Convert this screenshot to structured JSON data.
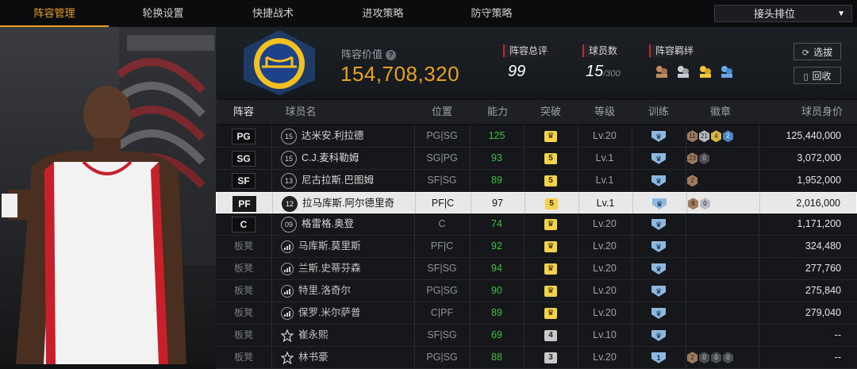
{
  "tabs": [
    {
      "label": "阵容管理",
      "active": true
    },
    {
      "label": "轮换设置",
      "active": false
    },
    {
      "label": "快捷战术",
      "active": false
    },
    {
      "label": "进攻策略",
      "active": false
    },
    {
      "label": "防守策略",
      "active": false
    }
  ],
  "dropdown": {
    "selected": "接头排位"
  },
  "header": {
    "value_label": "阵容价值",
    "value": "154,708,320",
    "rating_label": "阵容总评",
    "rating": "99",
    "player_count_label": "球员数",
    "player_count": "15",
    "player_count_max": "/300",
    "bond_label": "阵容羁绊",
    "btn_select": "选拔",
    "btn_recycle": "回收"
  },
  "columns": [
    "阵容",
    "球员名",
    "位置",
    "能力",
    "突破",
    "等级",
    "训练",
    "徽章",
    "球员身价"
  ],
  "players": [
    {
      "slot": "PG",
      "bench": false,
      "jersey": "15",
      "name": "达米安.利拉德",
      "pos": "PG|SG",
      "ability": "125",
      "breakthrough": "crown",
      "level": "Lv.20",
      "train": "crown",
      "badges": [
        {
          "t": "bronze",
          "v": "11"
        },
        {
          "t": "silver",
          "v": "21"
        },
        {
          "t": "gold",
          "v": "4"
        },
        {
          "t": "blue",
          "v": "2"
        }
      ],
      "worth": "125,440,000"
    },
    {
      "slot": "SG",
      "bench": false,
      "jersey": "15",
      "name": "C.J.麦科勒姆",
      "pos": "SG|PG",
      "ability": "93",
      "breakthrough": "5",
      "level": "Lv.1",
      "train": "crown",
      "badges": [
        {
          "t": "bronze",
          "v": "23"
        },
        {
          "t": "dark",
          "v": "0"
        }
      ],
      "worth": "3,072,000"
    },
    {
      "slot": "SF",
      "bench": false,
      "jersey": "13",
      "name": "尼古拉斯.巴图姆",
      "pos": "SF|SG",
      "ability": "89",
      "breakthrough": "5",
      "level": "Lv.1",
      "train": "crown",
      "badges": [
        {
          "t": "bronze",
          "v": "2"
        }
      ],
      "worth": "1,952,000"
    },
    {
      "slot": "PF",
      "bench": false,
      "jersey": "12",
      "name": "拉马库斯.阿尔德里奇",
      "pos": "PF|C",
      "ability": "97",
      "breakthrough": "5",
      "level": "Lv.1",
      "train": "crown",
      "badges": [
        {
          "t": "bronze",
          "v": "8"
        },
        {
          "t": "silver",
          "v": "0"
        }
      ],
      "worth": "2,016,000",
      "selected": true
    },
    {
      "slot": "C",
      "bench": false,
      "jersey": "09",
      "name": "格雷格.奥登",
      "pos": "C",
      "ability": "74",
      "breakthrough": "crown",
      "level": "Lv.20",
      "train": "crown",
      "badges": [],
      "worth": "1,171,200"
    },
    {
      "slot": "板凳",
      "bench": true,
      "icon": "rank",
      "name": "马库斯.莫里斯",
      "pos": "PF|C",
      "ability": "92",
      "breakthrough": "crown",
      "level": "Lv.20",
      "train": "crown",
      "badges": [],
      "worth": "324,480"
    },
    {
      "slot": "板凳",
      "bench": true,
      "icon": "rank",
      "name": "兰斯.史蒂芬森",
      "pos": "SF|SG",
      "ability": "94",
      "breakthrough": "crown",
      "level": "Lv.20",
      "train": "crown",
      "badges": [],
      "worth": "277,760"
    },
    {
      "slot": "板凳",
      "bench": true,
      "icon": "rank",
      "name": "特里.洛奇尔",
      "pos": "PG|SG",
      "ability": "90",
      "breakthrough": "crown",
      "level": "Lv.20",
      "train": "crown",
      "badges": [],
      "worth": "275,840"
    },
    {
      "slot": "板凳",
      "bench": true,
      "icon": "rank",
      "name": "保罗.米尔萨普",
      "pos": "C|PF",
      "ability": "89",
      "breakthrough": "crown",
      "level": "Lv.20",
      "train": "crown",
      "badges": [],
      "worth": "279,040"
    },
    {
      "slot": "板凳",
      "bench": true,
      "icon": "star",
      "name": "崔永熙",
      "pos": "SF|SG",
      "ability": "69",
      "breakthrough": "4",
      "level": "Lv.10",
      "train": "crown",
      "badges": [],
      "worth": "--"
    },
    {
      "slot": "板凳",
      "bench": true,
      "icon": "star",
      "name": "林书豪",
      "pos": "PG|SG",
      "ability": "88",
      "breakthrough": "3",
      "level": "Lv.20",
      "train": "1",
      "badges": [
        {
          "t": "bronze",
          "v": "2"
        },
        {
          "t": "dark",
          "v": "0"
        },
        {
          "t": "dark",
          "v": "0"
        },
        {
          "t": "dark",
          "v": "0"
        }
      ],
      "worth": "--"
    }
  ],
  "colors": {
    "accent": "#e8a21f",
    "ability_green": "#3fbf3f",
    "bond_red": "#c0282b"
  }
}
